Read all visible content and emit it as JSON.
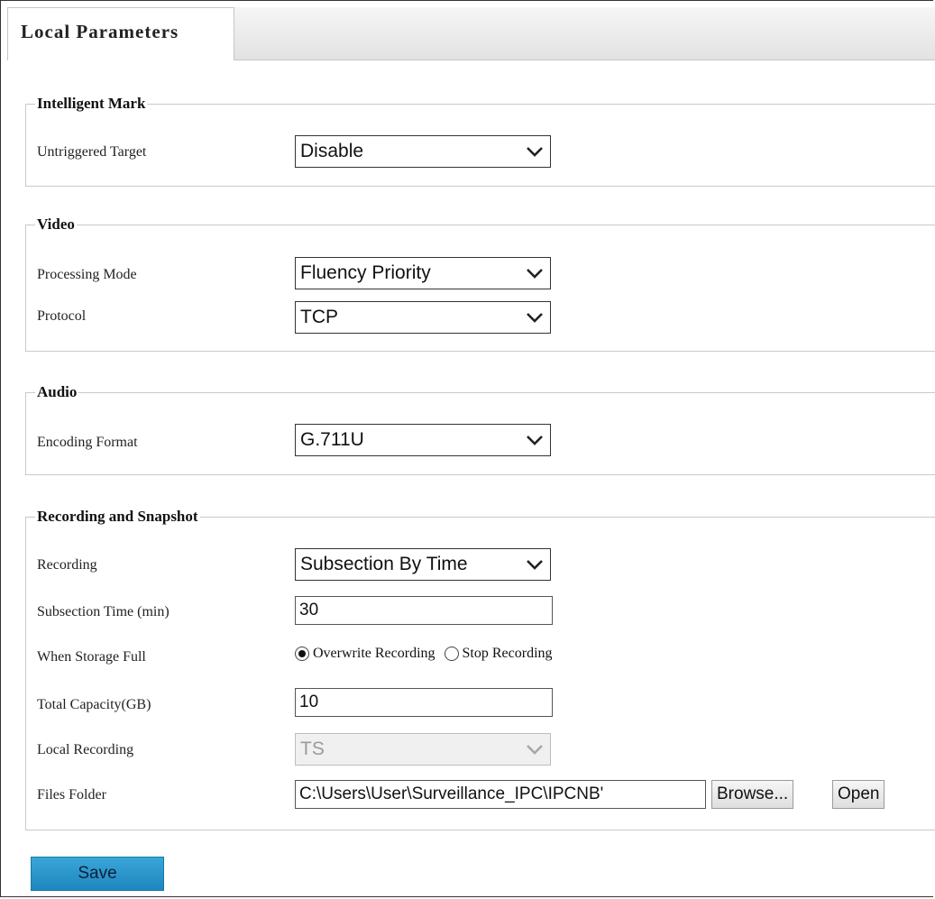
{
  "tabs": {
    "active": "Local Parameters"
  },
  "intelligent_mark": {
    "title": "Intelligent Mark",
    "untriggered_target": {
      "label": "Untriggered Target",
      "value": "Disable"
    }
  },
  "video": {
    "title": "Video",
    "processing_mode": {
      "label": "Processing Mode",
      "value": "Fluency Priority"
    },
    "protocol": {
      "label": "Protocol",
      "value": "TCP"
    }
  },
  "audio": {
    "title": "Audio",
    "encoding_format": {
      "label": "Encoding Format",
      "value": "G.711U"
    }
  },
  "recording": {
    "title": "Recording and Snapshot",
    "recording": {
      "label": "Recording",
      "value": "Subsection By Time"
    },
    "subsection_time": {
      "label": "Subsection Time (min)",
      "value": "30"
    },
    "storage_full": {
      "label": "When Storage Full",
      "options": [
        "Overwrite Recording",
        "Stop Recording"
      ],
      "selected": "Overwrite Recording"
    },
    "total_capacity": {
      "label": "Total Capacity(GB)",
      "value": "10"
    },
    "local_recording": {
      "label": "Local Recording",
      "value": "TS"
    },
    "files_folder": {
      "label": "Files Folder",
      "value": "C:\\Users\\User\\Surveillance_IPC\\IPCNB'",
      "browse_label": "Browse...",
      "open_label": "Open"
    }
  },
  "save_label": "Save",
  "icons": {
    "dropdown": "chevron-down-icon"
  }
}
